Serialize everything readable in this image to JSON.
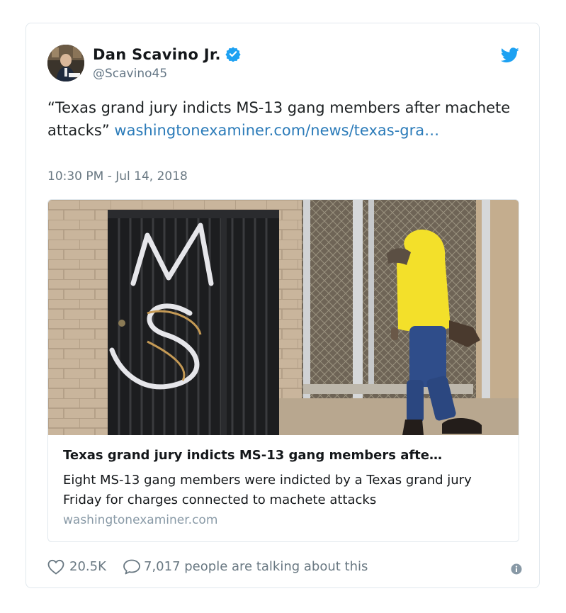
{
  "tweet": {
    "author_name": "Dan Scavino Jr.",
    "author_handle": "@Scavino45",
    "text_quote": "“Texas grand jury indicts MS-13 gang members after machete attacks”",
    "link_text": "washingtonexaminer.com/news/texas-gra…",
    "timestamp": "10:30 PM - Jul 14, 2018"
  },
  "card": {
    "title": "Texas grand jury indicts MS-13 gang members afte…",
    "description": "Eight MS-13 gang members were indicted by a Texas grand jury Friday for charges connected to machete attacks",
    "domain": "washingtonexaminer.com"
  },
  "footer": {
    "likes": "20.5K",
    "talking": "7,017 people are talking about this"
  },
  "icons": {
    "verified": "verified-badge-icon",
    "brand": "twitter-bird-icon",
    "like": "heart-icon",
    "reply": "speech-bubble-icon",
    "info": "info-icon"
  },
  "colors": {
    "link": "#2b7bb9",
    "verified": "#1da1f2",
    "muted_text": "#697882",
    "border": "#e1e8ed"
  }
}
